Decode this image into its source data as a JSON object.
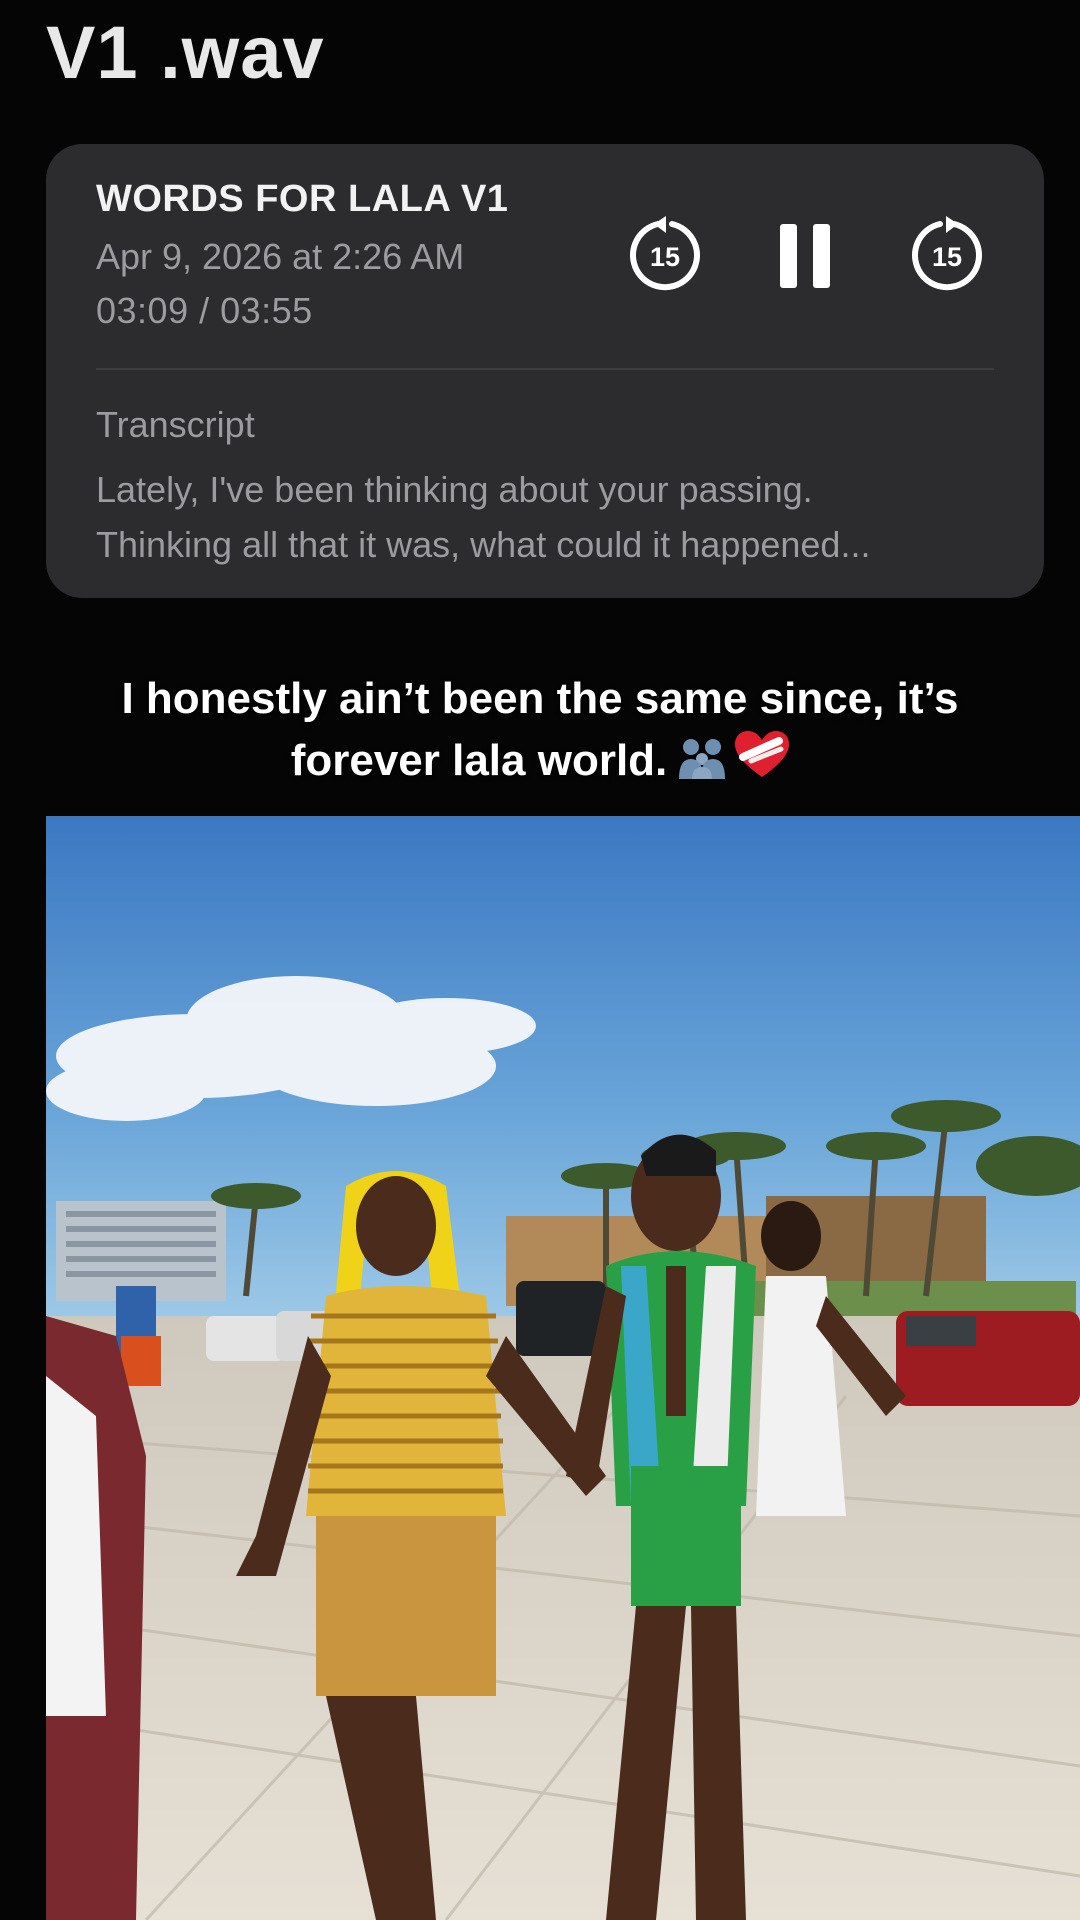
{
  "page": {
    "title": "V1 .wav"
  },
  "player": {
    "title": "WORDS FOR LALA V1",
    "date": "Apr 9, 2026 at 2:26 AM",
    "time": "03:09 / 03:55",
    "skip_back_label": "15",
    "skip_forward_label": "15",
    "progress": 0.8085
  },
  "transcript": {
    "label": "Transcript",
    "text": "Lately, I've been thinking about your passing.\nThinking all that it was, what could it happened..."
  },
  "caption": {
    "line1": "I honestly ain’t been the same since, it’s",
    "line2": "forever lala world."
  },
  "colors": {
    "card_bg": "#2c2c2e",
    "secondary_text": "#9b9ba0",
    "primary_text": "#f2f2f2",
    "sky_top": "#3d79c4",
    "sand": "#d9d3c8",
    "wig": "#f2d316"
  },
  "icons": [
    "skip-back-15-icon",
    "pause-icon",
    "skip-forward-15-icon",
    "family-emoji-icon",
    "mending-heart-emoji-icon"
  ]
}
